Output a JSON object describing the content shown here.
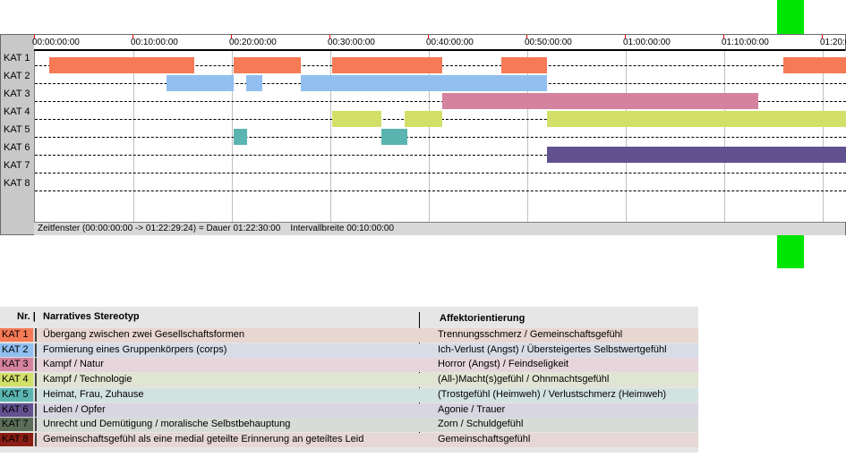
{
  "timeline": {
    "ticks": [
      "00:00:00:00",
      "00:10:00:00",
      "00:20:00:00",
      "00:30:00:00",
      "00:40:00:00",
      "00:50:00:00",
      "01:00:00:00",
      "01:10:00:00",
      "01:20:00:00"
    ],
    "rows": [
      "KAT 1",
      "KAT 2",
      "KAT 3",
      "KAT 4",
      "KAT 5",
      "KAT 6",
      "KAT 7",
      "KAT 8"
    ],
    "status": "Zeitfenster (00:00:00:00 -> 01:22:29:24) = Dauer 01:22:30:00    Intervallbreite 00:10:00:00",
    "row_colors": [
      "#f57a55",
      "#90bff0",
      "#d5829f",
      "#d2e06a",
      "#5ab5b0",
      "#62518f",
      "#5c6e58",
      "#8b1e14"
    ],
    "segments": [
      {
        "row": 0,
        "start": "00:01:25",
        "end": "00:16:10"
      },
      {
        "row": 0,
        "start": "00:20:10",
        "end": "00:27:00"
      },
      {
        "row": 0,
        "start": "00:30:10",
        "end": "00:41:20"
      },
      {
        "row": 0,
        "start": "00:47:20",
        "end": "00:52:00"
      },
      {
        "row": 0,
        "start": "01:16:00",
        "end": "01:22:29"
      },
      {
        "row": 1,
        "start": "00:13:20",
        "end": "00:20:10"
      },
      {
        "row": 1,
        "start": "00:21:25",
        "end": "00:23:05"
      },
      {
        "row": 1,
        "start": "00:27:00",
        "end": "00:52:00"
      },
      {
        "row": 2,
        "start": "00:41:20",
        "end": "01:13:30"
      },
      {
        "row": 3,
        "start": "00:30:10",
        "end": "00:35:10"
      },
      {
        "row": 3,
        "start": "00:37:30",
        "end": "00:41:20"
      },
      {
        "row": 3,
        "start": "00:52:00",
        "end": "01:22:29"
      },
      {
        "row": 4,
        "start": "00:20:10",
        "end": "00:21:35"
      },
      {
        "row": 4,
        "start": "00:35:10",
        "end": "00:37:50"
      },
      {
        "row": 5,
        "start": "00:52:00",
        "end": "01:22:29"
      }
    ]
  },
  "legend": {
    "header_nr": "Nr. |",
    "header_stereotype": "Narratives Stereotyp",
    "header_affect": "Affektorientierung",
    "items": [
      {
        "code": "KAT 1",
        "stereotype": "Übergang zwischen zwei Gesellschaftsformen",
        "affect": "Trennungsschmerz / Gemeinschaftsgefühl",
        "color": "#f57a55",
        "bg": "#e8d6d0"
      },
      {
        "code": "KAT 2",
        "stereotype": "Formierung eines Gruppenkörpers (corps)",
        "affect": "Ich-Verlust (Angst) / Übersteigertes Selbstwertgefühl",
        "color": "#90bff0",
        "bg": "#d6dde6"
      },
      {
        "code": "KAT 3",
        "stereotype": "Kampf / Natur",
        "affect": "Horror (Angst) / Feindseligkeit",
        "color": "#d5829f",
        "bg": "#e6d6dc"
      },
      {
        "code": "KAT 4",
        "stereotype": "Kampf / Technologie",
        "affect": "(All-)Macht(s)gefühl / Ohnmachtsgefühl",
        "color": "#d2e06a",
        "bg": "#e0e4d2"
      },
      {
        "code": "KAT 5",
        "stereotype": "Heimat, Frau, Zuhause",
        "affect": "(Trostgefühl (Heimweh) / Verlustschmerz (Heimweh)",
        "color": "#5ab5b0",
        "bg": "#d2e2e0"
      },
      {
        "code": "KAT 6",
        "stereotype": "Leiden / Opfer",
        "affect": "Agonie / Trauer",
        "color": "#62518f",
        "bg": "#d8d6e0"
      },
      {
        "code": "KAT 7",
        "stereotype": "Unrecht und Demütigung / moralische Selbstbehauptung",
        "affect": "Zorn / Schuldgefühl",
        "color": "#5c6e58",
        "bg": "#d8dcd6"
      },
      {
        "code": "KAT 8",
        "stereotype": "Gemeinschaftsgefühl als eine medial geteilte Erinnerung an geteiltes Leid",
        "affect": "Gemeinschaftsgefühl",
        "color": "#8b1e14",
        "bg": "#e6d6d4"
      }
    ]
  }
}
